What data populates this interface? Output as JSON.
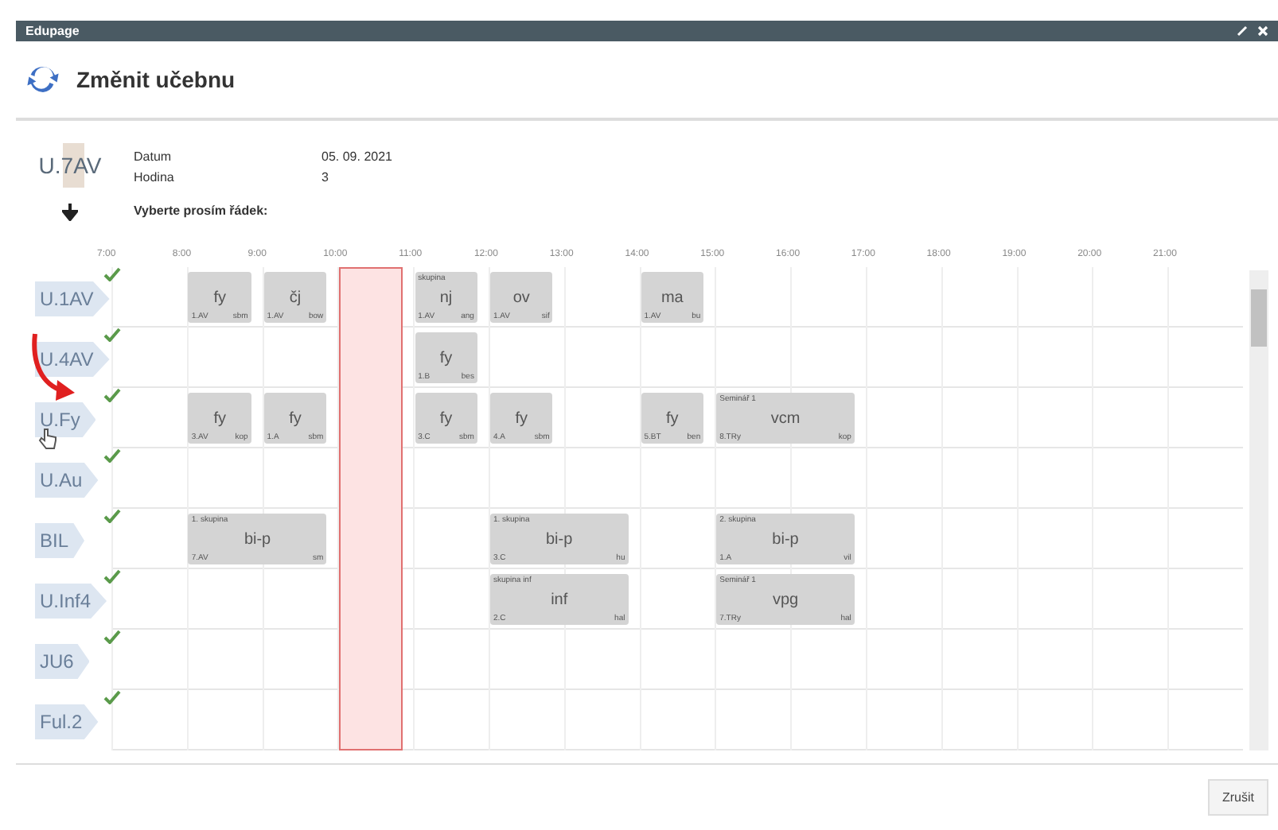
{
  "window": {
    "title": "Edupage"
  },
  "dialog": {
    "title": "Změnit učebnu"
  },
  "current_room": "U.7AV",
  "info": [
    {
      "label": "Datum",
      "value": "05. 09. 2021"
    },
    {
      "label": "Hodina",
      "value": "3"
    }
  ],
  "prompt": "Vyberte prosím řádek:",
  "hours": [
    {
      "label": "7:00",
      "selected": false
    },
    {
      "label": "8:00",
      "selected": false
    },
    {
      "label": "9:00",
      "selected": false
    },
    {
      "label": "10:00",
      "selected": true
    },
    {
      "label": "11:00",
      "selected": false
    },
    {
      "label": "12:00",
      "selected": false
    },
    {
      "label": "13:00",
      "selected": false
    },
    {
      "label": "14:00",
      "selected": false
    },
    {
      "label": "15:00",
      "selected": false
    },
    {
      "label": "16:00",
      "selected": false
    },
    {
      "label": "17:00",
      "selected": false
    },
    {
      "label": "18:00",
      "selected": false
    },
    {
      "label": "19:00",
      "selected": false
    },
    {
      "label": "20:00",
      "selected": false
    },
    {
      "label": "21:00",
      "selected": false
    }
  ],
  "rooms": [
    {
      "name": "U.1AV",
      "checked": true,
      "cells": [
        {
          "kind": "empty"
        },
        {
          "kind": "single",
          "subject": "fy",
          "class": "1.AV",
          "teacher": "sbm"
        },
        {
          "kind": "single",
          "subject": "čj",
          "class": "1.AV",
          "teacher": "bow"
        },
        {
          "kind": "empty"
        },
        {
          "kind": "single",
          "group": "skupina",
          "subject": "nj",
          "class": "1.AV",
          "teacher": "ang"
        },
        {
          "kind": "single",
          "subject": "ov",
          "class": "1.AV",
          "teacher": "sif"
        },
        {
          "kind": "empty"
        },
        {
          "kind": "single",
          "subject": "ma",
          "class": "1.AV",
          "teacher": "bu"
        }
      ]
    },
    {
      "name": "U.4AV",
      "checked": true,
      "cells": [
        {
          "kind": "empty"
        },
        {
          "kind": "empty"
        },
        {
          "kind": "empty"
        },
        {
          "kind": "empty"
        },
        {
          "kind": "single",
          "subject": "fy",
          "class": "1.B",
          "teacher": "bes"
        }
      ]
    },
    {
      "name": "U.Fy",
      "checked": true,
      "cells": [
        {
          "kind": "empty"
        },
        {
          "kind": "single",
          "subject": "fy",
          "class": "3.AV",
          "teacher": "kop"
        },
        {
          "kind": "single",
          "subject": "fy",
          "class": "1.A",
          "teacher": "sbm"
        },
        {
          "kind": "empty"
        },
        {
          "kind": "single",
          "subject": "fy",
          "class": "3.C",
          "teacher": "sbm"
        },
        {
          "kind": "single",
          "subject": "fy",
          "class": "4.A",
          "teacher": "sbm"
        },
        {
          "kind": "empty"
        },
        {
          "kind": "single",
          "subject": "fy",
          "class": "5.BT",
          "teacher": "ben"
        },
        {
          "kind": "double",
          "group": "Seminář 1",
          "subject": "vcm",
          "class": "8.TRy",
          "teacher": "kop"
        }
      ]
    },
    {
      "name": "U.Au",
      "checked": true
    },
    {
      "name": "BIL",
      "checked": true,
      "cells": [
        {
          "kind": "empty"
        },
        {
          "kind": "double",
          "group": "1. skupina",
          "subject": "bi-p",
          "class": "7.AV",
          "teacher": "sm"
        },
        {
          "kind": "empty"
        },
        {
          "kind": "empty"
        },
        {
          "kind": "double",
          "group": "1. skupina",
          "subject": "bi-p",
          "class": "3.C",
          "teacher": "hu"
        },
        {
          "kind": "empty"
        },
        {
          "kind": "double",
          "group": "2. skupina",
          "subject": "bi-p",
          "class": "1.A",
          "teacher": "vil"
        }
      ]
    },
    {
      "name": "U.Inf4",
      "checked": true,
      "cells": [
        {
          "kind": "empty"
        },
        {
          "kind": "empty"
        },
        {
          "kind": "empty"
        },
        {
          "kind": "empty"
        },
        {
          "kind": "empty"
        },
        {
          "kind": "double",
          "group": "skupina inf",
          "subject": "inf",
          "class": "2.C",
          "teacher": "hal"
        },
        {
          "kind": "empty"
        },
        {
          "kind": "double",
          "group": "Seminář 1",
          "subject": "vpg",
          "class": "7.TRy",
          "teacher": "hal"
        }
      ]
    },
    {
      "name": "JU6",
      "checked": true
    },
    {
      "name": "Ful.2",
      "checked": true
    }
  ],
  "buttons": [
    {
      "label": "Zrušit"
    }
  ]
}
